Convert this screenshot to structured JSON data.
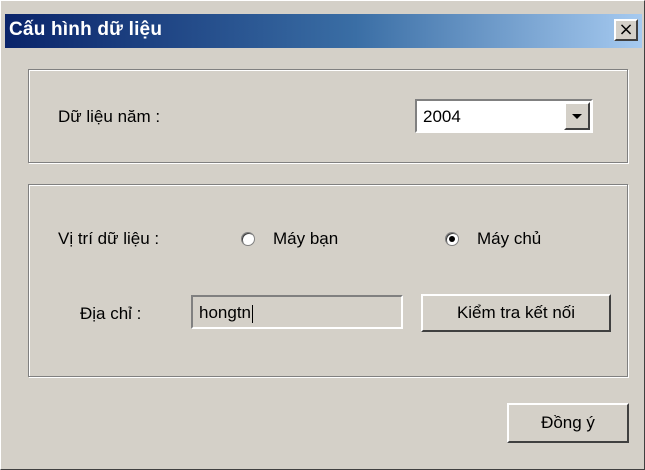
{
  "window": {
    "title": "Cấu hình dữ liệu",
    "close_label": "×"
  },
  "year_group": {
    "label": "Dữ liệu năm :",
    "selected": "2004"
  },
  "location_group": {
    "label": "Vị trí dữ liệu :",
    "options": [
      {
        "label": "Máy bạn",
        "checked": false
      },
      {
        "label": "Máy chủ",
        "checked": true
      }
    ],
    "address_label": "Địa chỉ :",
    "address_value": "hongtn",
    "test_button": "Kiểm tra kết nối"
  },
  "ok_button": "Đồng ý"
}
